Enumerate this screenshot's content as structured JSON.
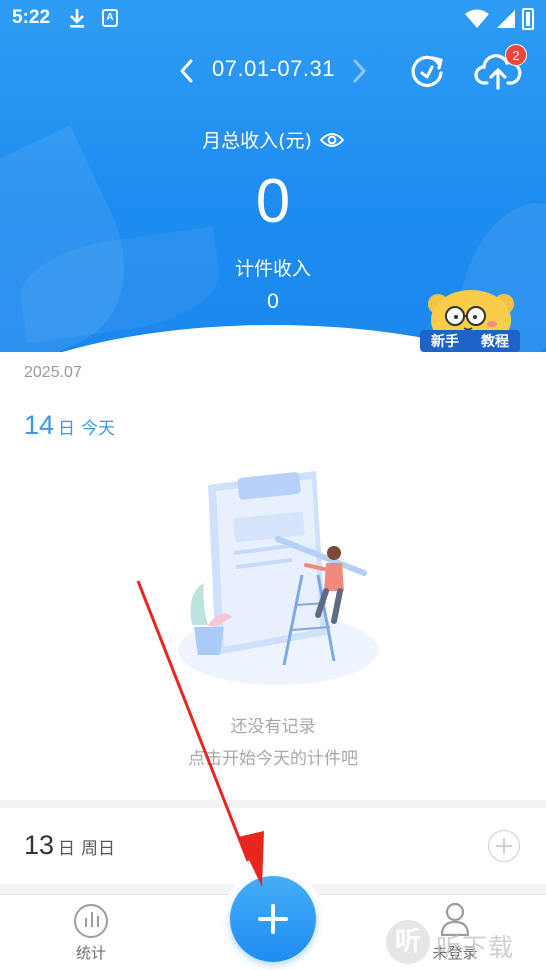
{
  "status_bar": {
    "time": "5:22",
    "a_icon_letter": "A"
  },
  "header": {
    "date_range": "07.01-07.31",
    "upload_badge_count": "2",
    "month_income_title": "月总收入(元)",
    "month_income_value": "0",
    "piece_income_label": "计件收入",
    "piece_income_value": "0",
    "tutorial_label_left": "新手",
    "tutorial_label_right": "教程"
  },
  "records": {
    "month_label": "2025.07",
    "today": {
      "day": "14",
      "unit": "日",
      "weekday": "今天"
    },
    "empty_title": "还没有记录",
    "empty_subtitle": "点击开始今天的计件吧",
    "previous": {
      "day": "13",
      "unit": "日",
      "weekday": "周日"
    }
  },
  "bottom_nav": {
    "stats_label": "统计",
    "me_label": "未登录"
  },
  "watermark": {
    "logo_char": "听",
    "text": "听下载"
  },
  "colors": {
    "header_blue": "#1d8cf0",
    "accent_blue": "#3a98ef",
    "badge_red": "#f0453a",
    "arrow_red": "#e8261d"
  }
}
